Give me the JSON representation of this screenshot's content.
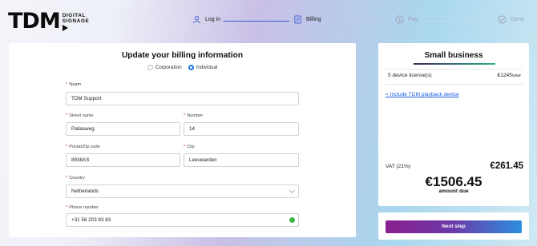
{
  "brand": {
    "name": "TDM",
    "sub_line1": "DIGITAL",
    "sub_line2": "SIGNAGE"
  },
  "steps": [
    {
      "label": "Log in",
      "icon": "user-icon",
      "state": "done"
    },
    {
      "label": "Billing",
      "icon": "document-icon",
      "state": "active"
    },
    {
      "label": "Pay",
      "icon": "dollar-icon",
      "state": "pending"
    },
    {
      "label": "Done",
      "icon": "check-circle-icon",
      "state": "pending"
    }
  ],
  "form": {
    "title": "Update your billing information",
    "account_types": [
      {
        "label": "Corporation",
        "selected": false
      },
      {
        "label": "Individual",
        "selected": true
      }
    ],
    "name": {
      "label": "Naam",
      "value": "TDM Support"
    },
    "street": {
      "label": "Street name",
      "value": "Pallasweg"
    },
    "number": {
      "label": "Number",
      "value": "14"
    },
    "postal": {
      "label": "Postal/Zip code",
      "value": "8938AS"
    },
    "city": {
      "label": "City",
      "value": "Leeuwarden"
    },
    "country": {
      "label": "Country",
      "value": "Netherlands"
    },
    "phone": {
      "label": "Phone number",
      "value": "+31 58 203 83 83"
    }
  },
  "summary": {
    "plan": "Small business",
    "license_label": "5 device license(s)",
    "license_price": "€1245",
    "license_period": "/year",
    "link": "< Include TDM playback device",
    "vat_label": "VAT (21%)",
    "vat_value": "€261.45",
    "total": "€1506.45",
    "total_label": "amount due"
  },
  "actions": {
    "next": "Next step"
  },
  "colors": {
    "accent": "#1a73e8",
    "success": "#3cb54a",
    "required": "#dd2222"
  }
}
